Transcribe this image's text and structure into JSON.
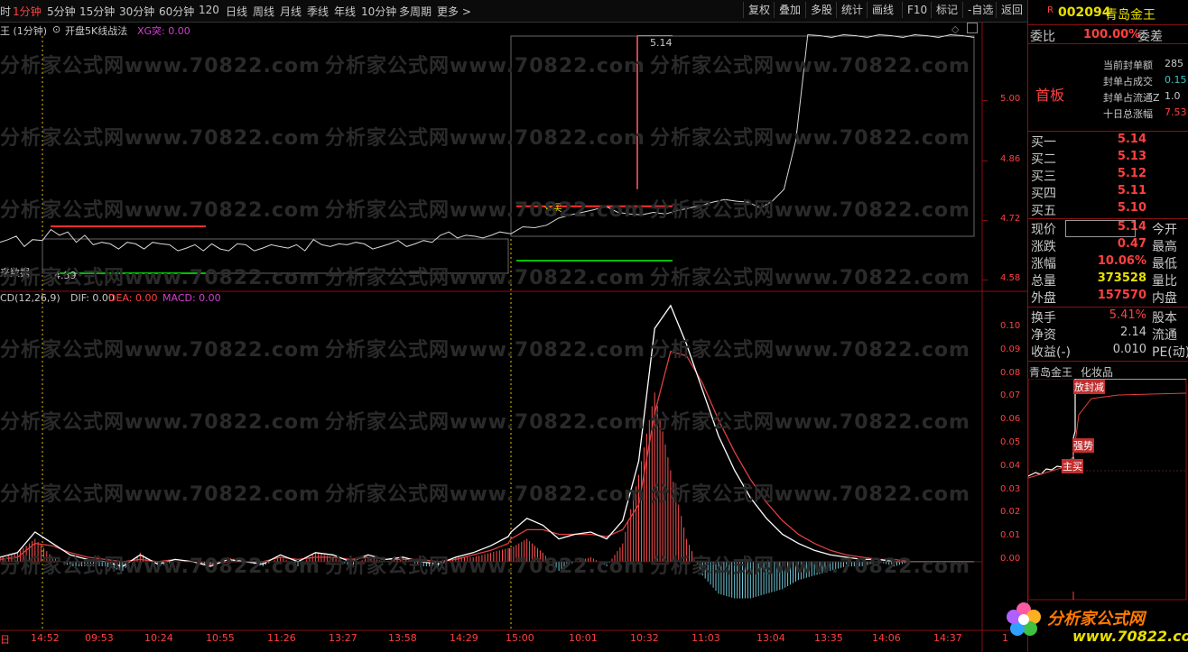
{
  "toolbar": {
    "periods": [
      "时",
      "1分钟",
      "5分钟",
      "15分钟",
      "30分钟",
      "60分钟",
      "120",
      "日线",
      "周线",
      "月线",
      "季线",
      "年线",
      "10分钟",
      "多周期",
      "更多 >"
    ],
    "active_period": "1分钟",
    "buttons": [
      "复权",
      "叠加",
      "多股",
      "统计",
      "画线",
      "F10",
      "标记",
      "-自选",
      "返回"
    ]
  },
  "chart": {
    "title": "王 (1分钟)",
    "indicator_name": "开盘5K线战法",
    "indicator_value": "XG突: 0.00",
    "price_label_top": "5.14",
    "price_label_low": "4.59",
    "buy_label": "买",
    "no_data_label": "来数据",
    "price_axis": [
      "5.00",
      "4.86",
      "4.72",
      "4.58"
    ],
    "macd_header": {
      "name": "CD(12,26,9)",
      "dif": "DIF: 0.00",
      "dea": "DEA: 0.00",
      "macd": "MACD: 0.00"
    },
    "macd_axis": [
      "0.10",
      "0.09",
      "0.08",
      "0.07",
      "0.06",
      "0.05",
      "0.04",
      "0.03",
      "0.02",
      "0.01",
      "0.00"
    ],
    "time_axis": [
      "日",
      "14:52",
      "09:53",
      "10:24",
      "10:55",
      "11:26",
      "13:27",
      "13:58",
      "14:29",
      "15:00",
      "10:01",
      "10:32",
      "11:03",
      "13:04",
      "13:35",
      "14:06",
      "14:37",
      "1"
    ],
    "watermark": "分析家公式网www.70822.com"
  },
  "chart_data": {
    "type": "line",
    "title": "",
    "price_series": {
      "name": "",
      "y": [
        4.66,
        4.66,
        4.67,
        4.65,
        4.66,
        4.66,
        4.69,
        4.67,
        4.68,
        4.66,
        4.67,
        4.65,
        4.66,
        4.65,
        4.64,
        4.66,
        4.65,
        4.64,
        4.66,
        4.65,
        4.65,
        4.64,
        4.64,
        4.65,
        4.64,
        4.65,
        4.64,
        4.64,
        4.65,
        4.65,
        4.64,
        4.64,
        4.65,
        4.65,
        4.64,
        4.65,
        4.64,
        4.66,
        4.65,
        4.65,
        4.65,
        4.65,
        4.66,
        4.65,
        4.64,
        4.65,
        4.65,
        4.66,
        4.65,
        4.65,
        4.66,
        4.66,
        4.67,
        4.68,
        4.67,
        4.67,
        4.67,
        4.67,
        4.67,
        4.68,
        4.68,
        4.69,
        4.69,
        4.7,
        4.71,
        4.72,
        4.73,
        4.73,
        4.74,
        4.73,
        4.72,
        4.72,
        4.73,
        4.72,
        4.73,
        4.74,
        4.74,
        4.75,
        4.76,
        4.75,
        4.75,
        4.74,
        4.75,
        4.78,
        4.9,
        5.14,
        5.14,
        5.14,
        5.14,
        5.14,
        5.14,
        5.14,
        5.14,
        5.14,
        5.14,
        5.14,
        5.14,
        5.14,
        5.14,
        5.14
      ],
      "ylim": [
        4.56,
        5.16
      ]
    },
    "red_line": 4.74,
    "green_line": 4.62,
    "macd": {
      "ylim": [
        -0.03,
        0.11
      ],
      "dif": [
        0.002,
        0.004,
        0.013,
        0.008,
        0.003,
        0.001,
        0.0,
        -0.002,
        0.003,
        -0.001,
        0.001,
        0.0,
        -0.002,
        0.001,
        0.0,
        -0.001,
        0.003,
        0.0,
        0.004,
        0.003,
        0.0,
        0.003,
        0.001,
        0.002,
        0.0,
        -0.001,
        0.002,
        0.004,
        0.007,
        0.011,
        0.013,
        0.019,
        0.016,
        0.01,
        0.012,
        0.013,
        0.01,
        0.018,
        0.044,
        0.102,
        0.112,
        0.095,
        0.075,
        0.055,
        0.04,
        0.028,
        0.019,
        0.012,
        0.008,
        0.005,
        0.003,
        0.002,
        0.001,
        0.001,
        0.0,
        0.0,
        0.0,
        0.0,
        0.0,
        0.0
      ],
      "dea": [
        0.001,
        0.002,
        0.008,
        0.007,
        0.004,
        0.002,
        0.001,
        0.0,
        0.001,
        0.0,
        0.001,
        0.0,
        -0.001,
        0.0,
        0.0,
        0.0,
        0.002,
        0.001,
        0.002,
        0.002,
        0.001,
        0.002,
        0.001,
        0.001,
        0.001,
        0.0,
        0.001,
        0.003,
        0.005,
        0.008,
        0.01,
        0.014,
        0.014,
        0.012,
        0.012,
        0.012,
        0.011,
        0.014,
        0.025,
        0.065,
        0.092,
        0.09,
        0.078,
        0.062,
        0.048,
        0.036,
        0.026,
        0.018,
        0.012,
        0.008,
        0.005,
        0.003,
        0.002,
        0.001,
        0.001,
        0.0,
        0.0,
        0.0,
        0.0,
        0.0
      ]
    }
  },
  "right_panel": {
    "badge": "R",
    "code": "002094",
    "name": "青岛金王",
    "weibi_label": "委比",
    "weibi_value": "100.00%",
    "weicha_label": "委差",
    "board_label": "首板",
    "seal_info": [
      {
        "label": "当前封单额",
        "value": "285"
      },
      {
        "label": "封单占成交",
        "value": "0.15"
      },
      {
        "label": "封单占流通Z",
        "value": "1.0"
      },
      {
        "label": "十日总涨幅",
        "value": "7.53"
      }
    ],
    "bids": [
      {
        "label": "买一",
        "value": "5.14"
      },
      {
        "label": "买二",
        "value": "5.13"
      },
      {
        "label": "买三",
        "value": "5.12"
      },
      {
        "label": "买四",
        "value": "5.11"
      },
      {
        "label": "买五",
        "value": "5.10"
      }
    ],
    "quote": [
      {
        "label": "现价",
        "value": "5.14",
        "label2": "今开"
      },
      {
        "label": "涨跌",
        "value": "0.47",
        "label2": "最高"
      },
      {
        "label": "涨幅",
        "value": "10.06%",
        "label2": "最低"
      },
      {
        "label": "总量",
        "value": "373528",
        "label2": "量比"
      },
      {
        "label": "外盘",
        "value": "157570",
        "label2": "内盘"
      }
    ],
    "stats": [
      {
        "label": "换手",
        "value": "5.41%",
        "label2": "股本"
      },
      {
        "label": "净资",
        "value": "2.14",
        "label2": "流通"
      },
      {
        "label": "收益(-)",
        "value": "0.010",
        "label2": "PE(动)"
      }
    ],
    "industry_name": "青岛金王",
    "industry": "化妆品",
    "mini_tags": [
      "放封减",
      "强势",
      "主买"
    ],
    "logo_text": "分析家公式网",
    "logo_url": "www.70822.com"
  },
  "colors": {
    "up": "#ff4040",
    "down": "#40c0c0",
    "yellow": "#e8e000",
    "green": "#00d000",
    "axis_red": "#8a1010",
    "magenta": "#d040d0"
  }
}
